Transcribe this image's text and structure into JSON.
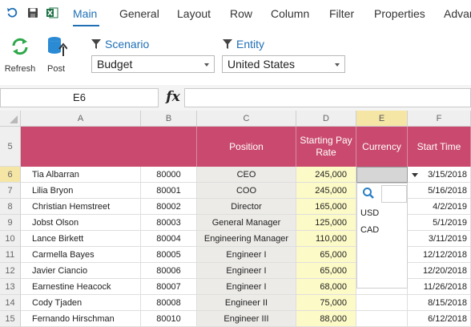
{
  "toolbar": {
    "tabs": [
      {
        "label": "Main",
        "active": true
      },
      {
        "label": "General"
      },
      {
        "label": "Layout"
      },
      {
        "label": "Row"
      },
      {
        "label": "Column"
      },
      {
        "label": "Filter"
      },
      {
        "label": "Properties"
      },
      {
        "label": "Advar"
      }
    ]
  },
  "ribbon": {
    "refresh_label": "Refresh",
    "post_label": "Post",
    "scenario_title": "Scenario",
    "scenario_value": "Budget",
    "entity_title": "Entity",
    "entity_value": "United States"
  },
  "formula_bar": {
    "cell_ref": "E6",
    "fx_label": "fx",
    "value": ""
  },
  "grid": {
    "columns": [
      "A",
      "B",
      "C",
      "D",
      "E",
      "F"
    ],
    "headers": {
      "position": "Position",
      "pay": "Starting Pay Rate",
      "currency": "Currency",
      "start": "Start Time"
    },
    "header_row": "5",
    "rows": [
      {
        "row": "6",
        "name": "Tia Albarran",
        "id": "80000",
        "position": "CEO",
        "pay": "245,000",
        "start": "3/15/2018"
      },
      {
        "row": "7",
        "name": "Lilia Bryon",
        "id": "80001",
        "position": "COO",
        "pay": "245,000",
        "start": "5/16/2018"
      },
      {
        "row": "8",
        "name": "Christian Hemstreet",
        "id": "80002",
        "position": "Director",
        "pay": "165,000",
        "start": "4/2/2019"
      },
      {
        "row": "9",
        "name": "Jobst Olson",
        "id": "80003",
        "position": "General Manager",
        "pay": "125,000",
        "start": "5/1/2019"
      },
      {
        "row": "10",
        "name": "Lance Birkett",
        "id": "80004",
        "position": "Engineering Manager",
        "pay": "110,000",
        "start": "3/11/2019"
      },
      {
        "row": "11",
        "name": "Carmella Bayes",
        "id": "80005",
        "position": "Engineer I",
        "pay": "65,000",
        "start": "12/12/2018"
      },
      {
        "row": "12",
        "name": "Javier Ciancio",
        "id": "80006",
        "position": "Engineer I",
        "pay": "65,000",
        "start": "12/20/2018"
      },
      {
        "row": "13",
        "name": "Earnestine Heacock",
        "id": "80007",
        "position": "Engineer I",
        "pay": "68,000",
        "start": "11/26/2018"
      },
      {
        "row": "14",
        "name": "Cody Tjaden",
        "id": "80008",
        "position": "Engineer II",
        "pay": "75,000",
        "start": "8/15/2018"
      },
      {
        "row": "15",
        "name": "Fernando Hirschman",
        "id": "80010",
        "position": "Engineer III",
        "pay": "88,000",
        "start": "6/12/2018"
      }
    ]
  },
  "currency_dropdown": {
    "options": [
      "USD",
      "CAD"
    ],
    "search_value": ""
  },
  "colors": {
    "header_fill": "#c94a6e",
    "accent": "#1f6fb5",
    "pay_fill": "#fcfac6",
    "position_fill": "#ecebe8"
  }
}
